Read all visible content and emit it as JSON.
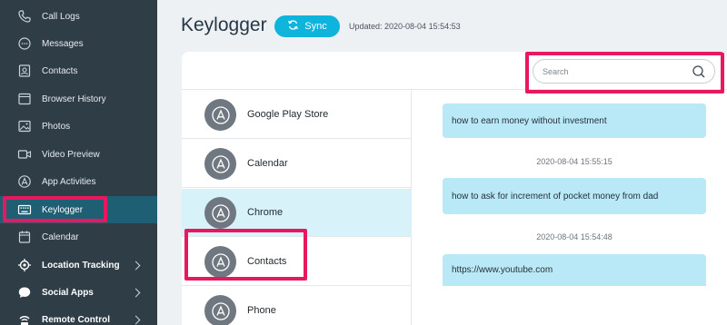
{
  "sidebar": {
    "items": [
      {
        "label": "Call Logs",
        "icon": "phone-icon"
      },
      {
        "label": "Messages",
        "icon": "chat-bubble-icon"
      },
      {
        "label": "Contacts",
        "icon": "contacts-icon"
      },
      {
        "label": "Browser History",
        "icon": "browser-icon"
      },
      {
        "label": "Photos",
        "icon": "image-icon"
      },
      {
        "label": "Video Preview",
        "icon": "video-icon"
      },
      {
        "label": "App Activities",
        "icon": "app-store-icon"
      },
      {
        "label": "Keylogger",
        "icon": "keyboard-icon",
        "active": true
      },
      {
        "label": "Calendar",
        "icon": "calendar-icon"
      },
      {
        "label": "Location Tracking",
        "icon": "location-icon",
        "expandable": true
      },
      {
        "label": "Social Apps",
        "icon": "social-chat-icon",
        "expandable": true
      },
      {
        "label": "Remote Control",
        "icon": "remote-icon",
        "expandable": true
      }
    ]
  },
  "header": {
    "title": "Keylogger",
    "sync_label": "Sync",
    "updated": "Updated: 2020-08-04 15:54:53"
  },
  "search": {
    "placeholder": "Search",
    "value": ""
  },
  "apps": [
    {
      "label": "Google Play Store",
      "selected": false
    },
    {
      "label": "Calendar",
      "selected": false
    },
    {
      "label": "Chrome",
      "selected": true
    },
    {
      "label": "Contacts",
      "selected": false
    },
    {
      "label": "Phone",
      "selected": false
    }
  ],
  "messages": [
    {
      "text": "how to earn money without investment",
      "timestamp": "2020-08-04 15:55:15"
    },
    {
      "text": "how to ask for increment of pocket money from dad",
      "timestamp": "2020-08-04 15:54:48"
    },
    {
      "text": "https://www.youtube.com",
      "timestamp": ""
    }
  ],
  "colors": {
    "sidebar_bg": "#2f3d47",
    "active_bg": "#1f5f74",
    "accent": "#0fb4dc",
    "highlight": "#e8185e",
    "bubble": "#b9e8f6",
    "selected_row": "#d8f2fa"
  }
}
